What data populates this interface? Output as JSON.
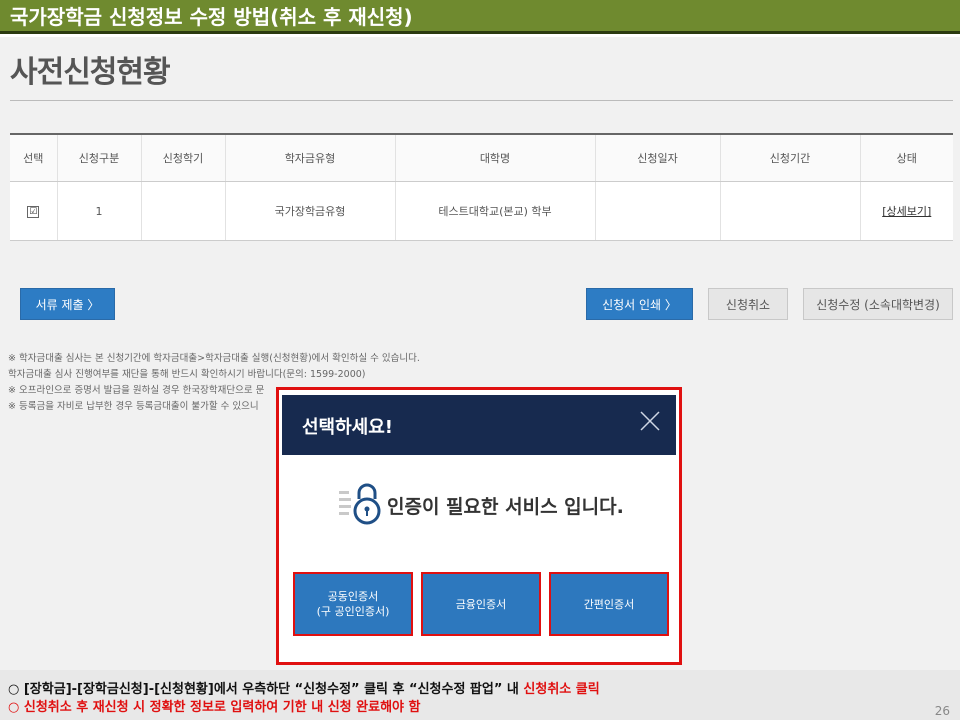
{
  "slide": {
    "title": "국가장학금 신청정보 수정 방법(취소 후 재신청)",
    "page_number": "26"
  },
  "page": {
    "title": "사전신청현황"
  },
  "table": {
    "headers": [
      "선택",
      "신청구분",
      "신청학기",
      "학자금유형",
      "대학명",
      "신청일자",
      "신청기간",
      "상태"
    ],
    "row": {
      "check": "☑",
      "category": "1",
      "semester": "",
      "type": "국가장학금유형",
      "university": "테스트대학교(본교) 학부",
      "date": "",
      "period": "",
      "status_link": "[상세보기]"
    }
  },
  "buttons": {
    "submit_docs": "서류 제출 〉",
    "print_application": "신청서 인쇄 〉",
    "cancel_application": "신청취소",
    "modify_application": "신청수정 (소속대학변경)"
  },
  "notes": [
    "※ 학자금대출 심사는 본 신청기간에 학자금대출>학자금대출 실행(신청현황)에서 확인하실 수 있습니다.",
    "   학자금대출 심사 진행여부를 재단을 통해 반드시 확인하시기 바랍니다(문의: 1599-2000)",
    "※ 오프라인으로 증명서 발급을 원하실 경우 한국장학재단으로 문",
    "※ 등록금을 자비로 납부한 경우 등록금대출이 불가할 수 있으니"
  ],
  "modal": {
    "title": "선택하세요!",
    "message": "인증이 필요한 서비스 입니다.",
    "cert_buttons": [
      {
        "line1": "공동인증서",
        "line2": "(구 공인인증서)"
      },
      {
        "line1": "금융인증서",
        "line2": ""
      },
      {
        "line1": "간편인증서",
        "line2": ""
      }
    ]
  },
  "footer": {
    "line1_prefix": "○ [장학금]-[장학금신청]-[신청현황]에서 우측하단 “신청수정” 클릭 후 “신청수정 팝업” 내 ",
    "line1_highlight": "신청취소 클릭",
    "line2": "○ 신청취소 후 재신청 시 정확한 정보로 입력하여 기한 내 신청 완료해야 함"
  },
  "colors": {
    "title_bar": "#6f8a2f",
    "primary_button": "#2d7cc4",
    "modal_header": "#172a4f",
    "highlight_red": "#e01010"
  }
}
